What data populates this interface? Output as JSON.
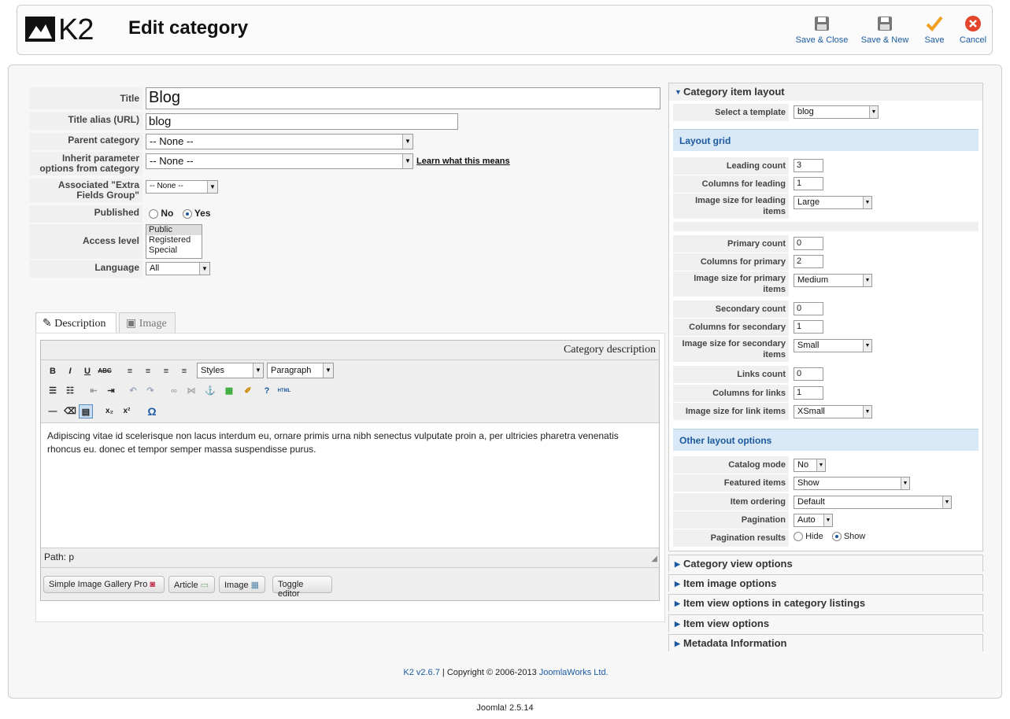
{
  "brand": {
    "logo_text": "K2"
  },
  "header": {
    "title": "Edit category"
  },
  "toolbar": {
    "save_close": "Save & Close",
    "save_new": "Save & New",
    "save": "Save",
    "cancel": "Cancel"
  },
  "form": {
    "title_label": "Title",
    "title_value": "Blog",
    "alias_label": "Title alias (URL)",
    "alias_value": "blog",
    "parent_label": "Parent category",
    "parent_value": "-- None --",
    "inherit_label": "Inherit parameter options from category",
    "inherit_value": "-- None --",
    "inherit_link": "Learn what this means",
    "extra_label": "Associated \"Extra Fields Group\"",
    "extra_value": "-- None --",
    "published_label": "Published",
    "published_no": "No",
    "published_yes": "Yes",
    "access_label": "Access level",
    "access_options": [
      "Public",
      "Registered",
      "Special"
    ],
    "language_label": "Language",
    "language_value": "All"
  },
  "tabs": {
    "description": "Description",
    "image": "Image"
  },
  "editor": {
    "heading": "Category description",
    "styles": "Styles",
    "format": "Paragraph",
    "content": "Adipiscing vitae id scelerisque non lacus interdum eu, ornare primis urna nibh senectus vulputate proin a, per ultricies pharetra venenatis rhoncus eu. donec et tempor semper massa suspendisse purus.",
    "path": "Path: p",
    "buttons": [
      "Simple Image Gallery Pro",
      "Article",
      "Image",
      "Toggle editor"
    ]
  },
  "layout": {
    "section": "Category item layout",
    "template_label": "Select a template",
    "template_value": "blog",
    "grid_head": "Layout grid",
    "leading_count_label": "Leading count",
    "leading_count": "3",
    "columns_leading_label": "Columns for leading",
    "columns_leading": "1",
    "image_leading_label": "Image size for leading items",
    "image_leading": "Large",
    "primary_count_label": "Primary count",
    "primary_count": "0",
    "columns_primary_label": "Columns for primary",
    "columns_primary": "2",
    "image_primary_label": "Image size for primary items",
    "image_primary": "Medium",
    "secondary_count_label": "Secondary count",
    "secondary_count": "0",
    "columns_secondary_label": "Columns for secondary",
    "columns_secondary": "1",
    "image_secondary_label": "Image size for secondary items",
    "image_secondary": "Small",
    "links_count_label": "Links count",
    "links_count": "0",
    "columns_links_label": "Columns for links",
    "columns_links": "1",
    "image_links_label": "Image size for link items",
    "image_links": "XSmall",
    "other_head": "Other layout options",
    "catalog_label": "Catalog mode",
    "catalog_value": "No",
    "featured_label": "Featured items",
    "featured_value": "Show",
    "ordering_label": "Item ordering",
    "ordering_value": "Default",
    "pagination_label": "Pagination",
    "pagination_value": "Auto",
    "pagres_label": "Pagination results",
    "pagres_hide": "Hide",
    "pagres_show": "Show"
  },
  "collapsed": [
    "Category view options",
    "Item image options",
    "Item view options in category listings",
    "Item view options",
    "Metadata Information"
  ],
  "footer": {
    "version": "K2 v2.6.7",
    "copyright": " | Copyright © 2006-2013 ",
    "company": "JoomlaWorks Ltd.",
    "joomla": "Joomla! 2.5.14"
  },
  "colors": {
    "accent": "#1b5aa0",
    "save": "#f0a020",
    "cancel": "#e5452d"
  }
}
